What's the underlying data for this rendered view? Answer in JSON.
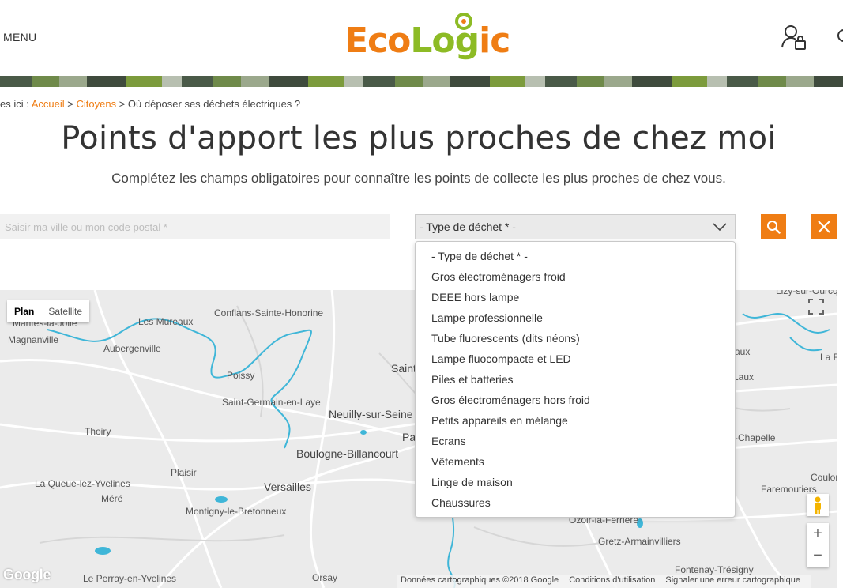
{
  "header": {
    "menu_label": "MENU",
    "logo": {
      "part1": "Eco",
      "part2": "Log",
      "part3": "ic"
    }
  },
  "breadcrumb": {
    "prefix": "es ici : ",
    "items": [
      "Accueil",
      "Citoyens",
      "Où déposer ses déchets électriques ?"
    ],
    "separator": " > "
  },
  "page": {
    "title": "Points d'apport les plus proches de chez moi",
    "subtitle": "Complétez les champs obligatoires pour connaître les points de collecte les plus proches de chez vous."
  },
  "form": {
    "city_placeholder": "Saisir ma ville ou mon code postal *",
    "waste_select": {
      "value": "- Type de déchet * -",
      "options": [
        "- Type de déchet * -",
        "Gros électroménagers froid",
        "DEEE hors lampe",
        "Lampe professionnelle",
        "Tube fluorescents (dits néons)",
        "Lampe fluocompacte et LED",
        "Piles et batteries",
        "Gros électroménagers hors froid",
        "Petits appareils en mélange",
        "Ecrans",
        "Vêtements",
        "Linge de maison",
        "Chaussures"
      ]
    }
  },
  "map": {
    "type_buttons": [
      "Plan",
      "Satellite"
    ],
    "active_type": "Plan",
    "zoom_in": "+",
    "zoom_out": "−",
    "google_logo": "Google",
    "attribution": [
      "Données cartographiques ©2018 Google",
      "Conditions d'utilisation",
      "Signaler une erreur cartographique"
    ],
    "labels": [
      "Mantes-la-Jolie",
      "Les Mureaux",
      "Conflans-Sainte-Honorine",
      "Magnanville",
      "Aubergenville",
      "Poissy",
      "Saint-Germain-en-Laye",
      "Neuilly-sur-Seine",
      "Thoiry",
      "Boulogne-Billancourt",
      "Plaisir",
      "Versailles",
      "La Queue-lez-Yvelines",
      "Méré",
      "Montigny-le-Bretonneux",
      "Le Perray-en-Yvelines",
      "Orsay",
      "Saint",
      "Pa",
      "Lizy-sur-Ourcq",
      "aux",
      "La F",
      "Laux",
      "-Chapelle",
      "Coulon",
      "Faremoutiers",
      "Ozoir-la-Ferrière",
      "Gretz-Armainvilliers",
      "Fontenay-Trésigny"
    ]
  },
  "colors": {
    "accent": "#ef7d14",
    "logo_green": "#8dbb25",
    "map_background": "#ebebeb",
    "water": "#3fb6d8"
  }
}
